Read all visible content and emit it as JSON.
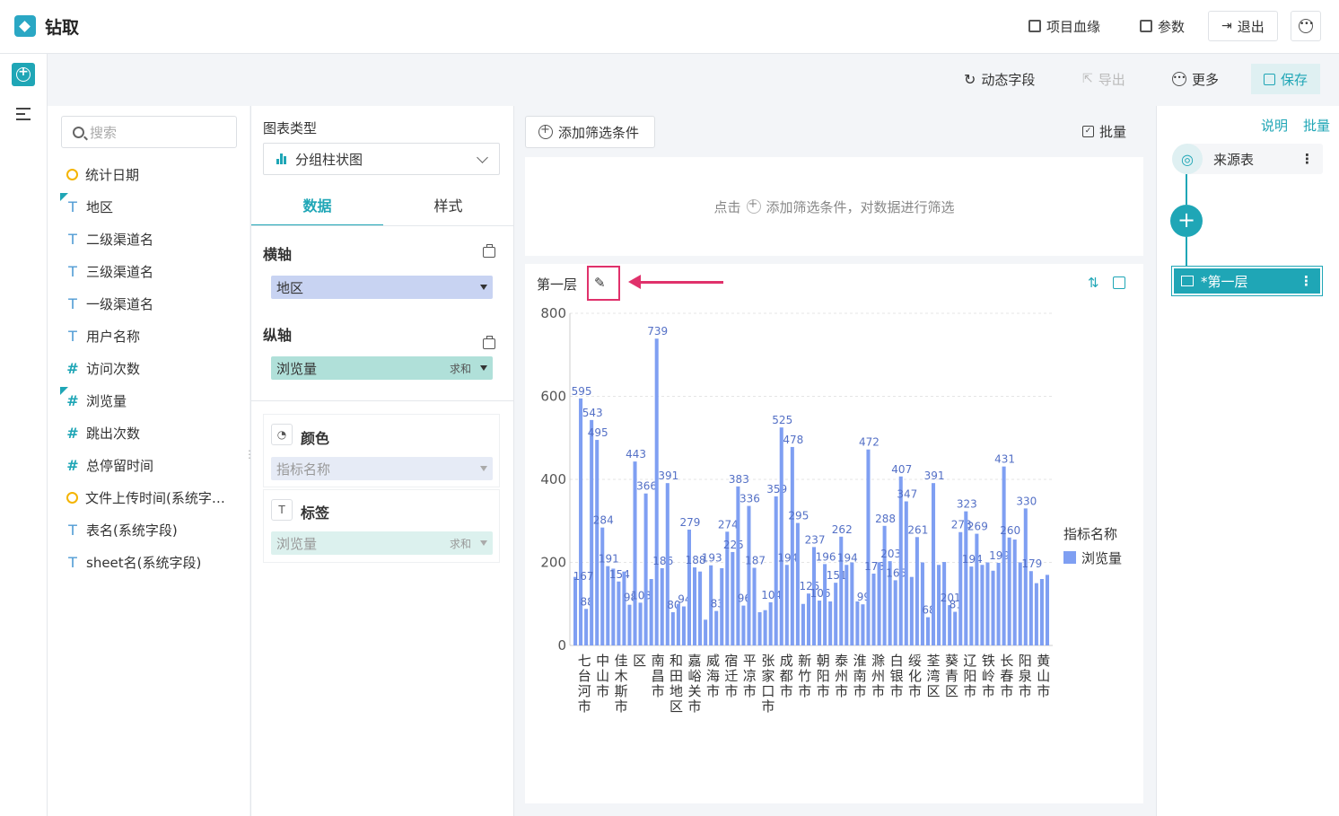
{
  "app": {
    "title": "钻取"
  },
  "topbar": {
    "lineage": "项目血缘",
    "params": "参数",
    "exit": "退出"
  },
  "toolbar": {
    "dynamic_field": "动态字段",
    "export": "导出",
    "more": "更多",
    "save": "保存"
  },
  "fields": {
    "search_placeholder": "搜索",
    "items": [
      {
        "label": "统计日期",
        "type": "date"
      },
      {
        "label": "地区",
        "type": "text",
        "marked": true
      },
      {
        "label": "二级渠道名",
        "type": "text"
      },
      {
        "label": "三级渠道名",
        "type": "text"
      },
      {
        "label": "一级渠道名",
        "type": "text"
      },
      {
        "label": "用户名称",
        "type": "text"
      },
      {
        "label": "访问次数",
        "type": "number"
      },
      {
        "label": "浏览量",
        "type": "number",
        "marked": true
      },
      {
        "label": "跳出次数",
        "type": "number"
      },
      {
        "label": "总停留时间",
        "type": "number"
      },
      {
        "label": "文件上传时间(系统字…",
        "type": "date"
      },
      {
        "label": "表名(系统字段)",
        "type": "text"
      },
      {
        "label": "sheet名(系统字段)",
        "type": "text"
      }
    ]
  },
  "config": {
    "chart_type_label": "图表类型",
    "chart_type_value": "分组柱状图",
    "tab_data": "数据",
    "tab_style": "样式",
    "x_axis_label": "横轴",
    "x_axis_field": "地区",
    "y_axis_label": "纵轴",
    "y_axis_field": "浏览量",
    "y_axis_agg": "求和",
    "color_label": "颜色",
    "color_field": "指标名称",
    "tag_label": "标签",
    "tag_field": "浏览量",
    "tag_agg": "求和"
  },
  "filter": {
    "add_button": "添加筛选条件",
    "batch": "批量",
    "hint_prefix": "点击",
    "hint_suffix": "添加筛选条件，对数据进行筛选"
  },
  "chart_card": {
    "layer_title": "第一层"
  },
  "right_panel": {
    "explain": "说明",
    "batch": "批量",
    "source_node": "来源表",
    "layer_node": "*第一层"
  },
  "colors": {
    "accent": "#1fa6b6",
    "bar": "#7f9ff2",
    "highlight": "#e0316b"
  },
  "chart_data": {
    "type": "bar",
    "title": "",
    "xlabel": "",
    "ylabel": "",
    "ylim": [
      0,
      800
    ],
    "yticks": [
      0,
      200,
      400,
      600,
      800
    ],
    "legend_title": "指标名称",
    "legend_position": "right",
    "grid": true,
    "x_tick_labels": [
      "七台河市",
      "中山市",
      "佳木斯市",
      "区",
      "南昌市",
      "和田地区",
      "嘉峪关市",
      "威海市",
      "宿迁市",
      "平凉市",
      "张家口市",
      "成都市",
      "新竹市",
      "朝阳市",
      "泰州市",
      "淮南市",
      "滁州市",
      "白银市",
      "绥化市",
      "荃湾区",
      "葵青区",
      "辽阳市",
      "铁岭市",
      "长春市",
      "阳泉市",
      "黄山市"
    ],
    "series": [
      {
        "name": "浏览量",
        "values": [
          165,
          595,
          88,
          543,
          495,
          284,
          191,
          185,
          154,
          178,
          98,
          443,
          103,
          366,
          160,
          739,
          186,
          391,
          80,
          100,
          94,
          279,
          188,
          178,
          62,
          193,
          83,
          186,
          274,
          225,
          383,
          96,
          336,
          187,
          80,
          85,
          104,
          359,
          525,
          194,
          478,
          295,
          100,
          125,
          237,
          108,
          196,
          106,
          151,
          262,
          194,
          200,
          106,
          99,
          472,
          173,
          200,
          288,
          203,
          157,
          407,
          347,
          165,
          261,
          200,
          68,
          391,
          194,
          201,
          97,
          81,
          273,
          323,
          190,
          269,
          194,
          200,
          180,
          199,
          431,
          260,
          255,
          200,
          330,
          179,
          150,
          160,
          170
        ],
        "labels": {
          "0": "",
          "1": "595",
          "2": "88",
          "3": "543",
          "4": "495",
          "5": "284",
          "6": "191",
          "8": "154",
          "10": "98",
          "11": "443",
          "12": "103",
          "13": "366",
          "15": "739",
          "16": "186",
          "17": "391",
          "18": "80",
          "20": "94",
          "21": "279",
          "22": "188",
          "25": "193",
          "26": "83",
          "28": "274",
          "29": "225",
          "30": "383",
          "31": "96",
          "32": "336",
          "33": "187",
          "36": "104",
          "37": "359",
          "38": "525",
          "39": "194",
          "40": "478",
          "41": "295",
          "43": "125",
          "44": "237",
          "45": "106",
          "46": "196",
          "48": "151",
          "49": "262",
          "50": "194",
          "53": "99",
          "54": "472",
          "55": "173",
          "57": "288",
          "58": "203",
          "59": "165",
          "60": "407",
          "61": "347",
          "63": "261",
          "65": "68",
          "66": "391",
          "69": "201",
          "70": "81",
          "71": "273",
          "72": "323",
          "73": "194",
          "74": "269",
          "78": "199",
          "79": "431",
          "80": "260",
          "83": "330",
          "84": "179",
          "1b": "167"
        }
      }
    ]
  }
}
